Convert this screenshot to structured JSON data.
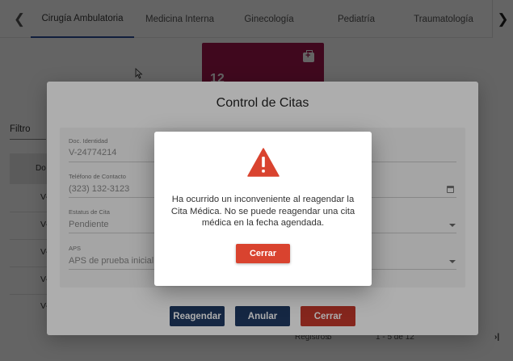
{
  "tabs": [
    {
      "label": "Cirugía Ambulatoria",
      "active": true
    },
    {
      "label": "Medicina Interna",
      "active": false
    },
    {
      "label": "Ginecología",
      "active": false
    },
    {
      "label": "Pediatría",
      "active": false
    },
    {
      "label": "Traumatología",
      "active": false
    }
  ],
  "icons": {
    "tab_prev": "chevron-left-icon",
    "tab_next": "chevron-right-icon",
    "card": "first-aid-kit-icon",
    "alert": "warning-triangle-icon"
  },
  "stat_card": {
    "count": "12",
    "color": "#a4184f"
  },
  "filter": {
    "label": "Filtro"
  },
  "table": {
    "header": "Do",
    "rows": [
      "V-",
      "V-",
      "V-",
      "V-",
      "V-"
    ]
  },
  "pager": {
    "label": "Registros",
    "per_page": "5",
    "range": "1 - 5 de 12"
  },
  "modal": {
    "title": "Control de Citas",
    "fields": {
      "doc_label": "Doc. Identidad",
      "doc_value": "V-24774214",
      "phone_label": "Teléfono de Contacto",
      "phone_value": "(323) 132-3123",
      "status_label": "Estatus de Cita",
      "status_value": "Pendiente",
      "aps_label": "APS",
      "aps_value": "APS de prueba inicial"
    },
    "buttons": {
      "reschedule": "Reagendar",
      "cancel_appt": "Anular",
      "close": "Cerrar"
    }
  },
  "alert": {
    "message": "Ha ocurrido un inconveniente al reagendar la Cita Médica. No se puede reagendar una cita médica en la fecha agendada.",
    "button": "Cerrar",
    "accent": "#d9432f"
  },
  "colors": {
    "primary": "#1f3a64",
    "danger": "#c4392b",
    "tab_indicator": "#2c4f9e"
  }
}
